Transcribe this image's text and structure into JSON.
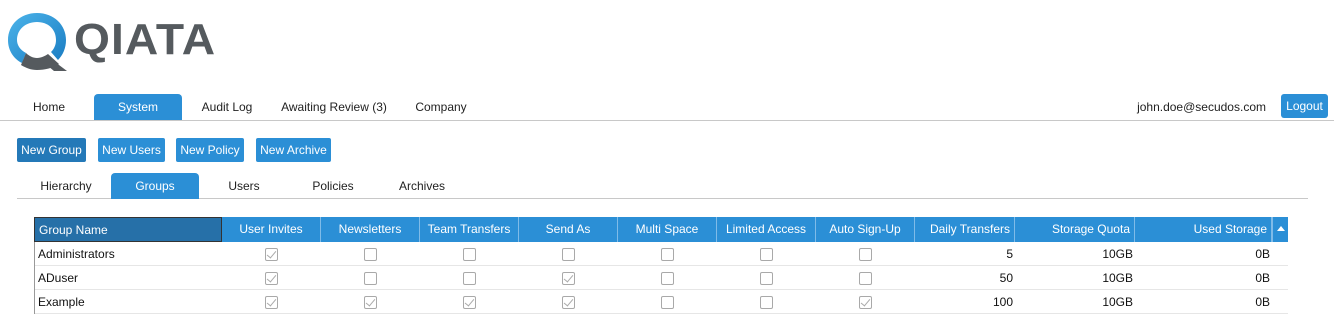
{
  "app": {
    "logo_text": "QIATA",
    "logo_icon": "qiata-q-logo"
  },
  "topnav": {
    "tabs": [
      {
        "label": "Home",
        "active": false
      },
      {
        "label": "System",
        "active": true
      },
      {
        "label": "Audit Log",
        "active": false
      },
      {
        "label": "Awaiting Review (3)",
        "active": false
      },
      {
        "label": "Company",
        "active": false
      }
    ],
    "user_email": "john.doe@secudos.com",
    "logout_label": "Logout"
  },
  "actions": {
    "new_group": "New Group",
    "new_users": "New Users",
    "new_policy": "New Policy",
    "new_archive": "New Archive"
  },
  "subnav": {
    "tabs": [
      {
        "label": "Hierarchy",
        "active": false
      },
      {
        "label": "Groups",
        "active": true
      },
      {
        "label": "Users",
        "active": false
      },
      {
        "label": "Policies",
        "active": false
      },
      {
        "label": "Archives",
        "active": false
      }
    ]
  },
  "grid": {
    "columns": [
      "Group Name",
      "User Invites",
      "Newsletters",
      "Team Transfers",
      "Send As",
      "Multi Space",
      "Limited Access",
      "Auto Sign-Up",
      "Daily Transfers",
      "Storage Quota",
      "Used Storage"
    ],
    "rows": [
      {
        "name": "Administrators",
        "flags": [
          true,
          false,
          false,
          false,
          false,
          false,
          false
        ],
        "daily": "5",
        "quota": "10GB",
        "used": "0B"
      },
      {
        "name": "ADuser",
        "flags": [
          true,
          false,
          false,
          true,
          false,
          false,
          false
        ],
        "daily": "50",
        "quota": "10GB",
        "used": "0B"
      },
      {
        "name": "Example",
        "flags": [
          true,
          true,
          true,
          true,
          false,
          false,
          true
        ],
        "daily": "100",
        "quota": "10GB",
        "used": "0B"
      }
    ]
  },
  "colors": {
    "accent": "#2b8fd6",
    "accent_dark": "#2479b8",
    "logo_gray": "#555a5e"
  }
}
